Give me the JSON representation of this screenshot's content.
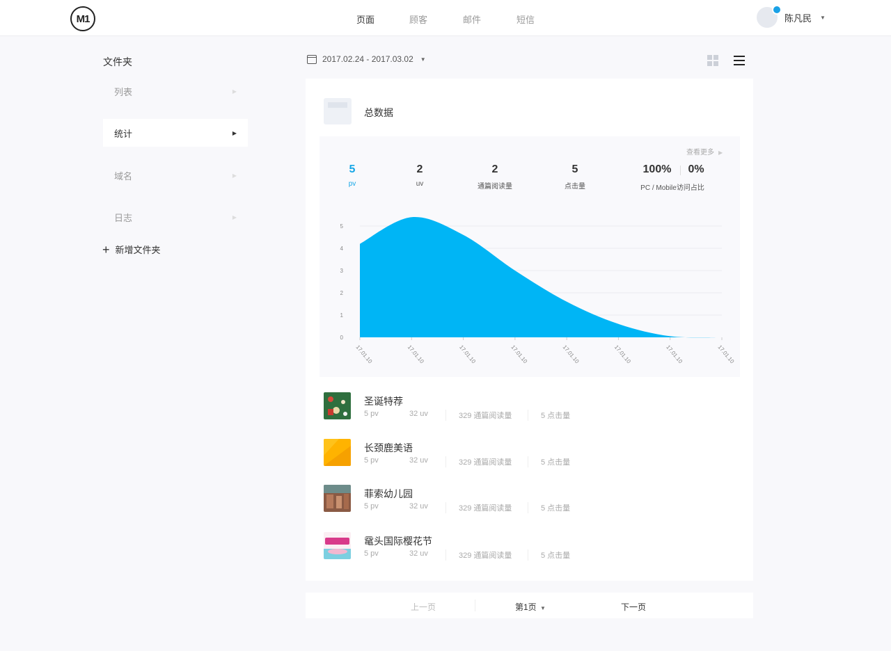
{
  "header": {
    "logo": "M1",
    "nav": [
      {
        "label": "页面",
        "active": true
      },
      {
        "label": "顾客",
        "active": false
      },
      {
        "label": "邮件",
        "active": false
      },
      {
        "label": "短信",
        "active": false
      }
    ],
    "user_name": "陈凡民"
  },
  "sidebar": {
    "title": "文件夹",
    "items": [
      {
        "label": "列表",
        "active": false
      },
      {
        "label": "统计",
        "active": true
      },
      {
        "label": "域名",
        "active": false
      },
      {
        "label": "日志",
        "active": false
      }
    ],
    "add_label": "新增文件夹"
  },
  "toolbar": {
    "date_range": "2017.02.24 - 2017.03.02"
  },
  "summary": {
    "title": "总数据",
    "see_more": "查看更多",
    "stats": [
      {
        "value": "5",
        "label": "pv"
      },
      {
        "value": "2",
        "label": "uv"
      },
      {
        "value": "2",
        "label": "通篇阅读量"
      },
      {
        "value": "5",
        "label": "点击量"
      },
      {
        "value": "100%",
        "label": ""
      },
      {
        "value": "0%",
        "label": ""
      }
    ],
    "ratio_label": "PC / Mobile访问占比"
  },
  "chart_data": {
    "type": "area",
    "x": [
      "17.01.10",
      "17.01.10",
      "17.01.10",
      "17.01.10",
      "17.01.10",
      "17.01.10",
      "17.01.10",
      "17.01.10"
    ],
    "values": [
      4.2,
      5.4,
      4.6,
      3.0,
      1.6,
      0.6,
      0.05,
      0
    ],
    "yticks": [
      "5",
      "4",
      "3",
      "2",
      "1",
      "0"
    ],
    "ylim": [
      0,
      5
    ],
    "color": "#00b5f5",
    "grid": true
  },
  "items": [
    {
      "title": "圣诞特荐",
      "pv": "5 pv",
      "uv": "32 uv",
      "reads": "329 通篇阅读量",
      "clicks": "5 点击量"
    },
    {
      "title": "长颈鹿美语",
      "pv": "5 pv",
      "uv": "32 uv",
      "reads": "329 通篇阅读量",
      "clicks": "5 点击量"
    },
    {
      "title": "菲索幼儿园",
      "pv": "5 pv",
      "uv": "32 uv",
      "reads": "329 通篇阅读量",
      "clicks": "5 点击量"
    },
    {
      "title": "鼋头国际樱花节",
      "pv": "5 pv",
      "uv": "32 uv",
      "reads": "329 通篇阅读量",
      "clicks": "5 点击量"
    }
  ],
  "pagination": {
    "prev": "上一页",
    "current": "第1页",
    "next": "下一页"
  }
}
